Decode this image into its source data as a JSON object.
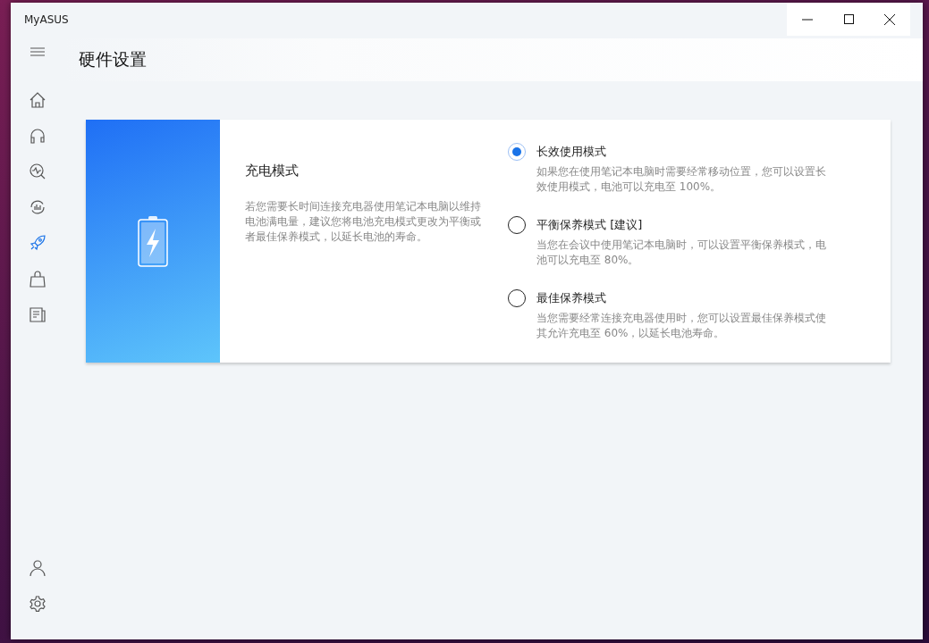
{
  "window": {
    "title": "MyASUS"
  },
  "sidebar": {
    "items": [
      {
        "kind": "home",
        "selected": false
      },
      {
        "kind": "headset",
        "selected": false
      },
      {
        "kind": "diagnostics",
        "selected": false
      },
      {
        "kind": "sync",
        "selected": false
      },
      {
        "kind": "rocket",
        "selected": true
      },
      {
        "kind": "bag",
        "selected": false
      },
      {
        "kind": "news",
        "selected": false
      }
    ],
    "bottom_items": [
      {
        "kind": "user",
        "selected": false
      },
      {
        "kind": "settings",
        "selected": false
      }
    ]
  },
  "page": {
    "title": "硬件设置"
  },
  "card": {
    "title": "充电模式",
    "description": "若您需要长时间连接充电器使用笔记本电脑以维持电池满电量，建议您将电池充电模式更改为平衡或者最佳保养模式，以延长电池的寿命。",
    "options": [
      {
        "label": "长效使用模式",
        "description": "如果您在使用笔记本电脑时需要经常移动位置，您可以设置长效使用模式，电池可以充电至 100%。",
        "selected": true
      },
      {
        "label": "平衡保养模式 [建议]",
        "description": "当您在会议中使用笔记本电脑时，可以设置平衡保养模式，电池可以充电至 80%。",
        "selected": false
      },
      {
        "label": "最佳保养模式",
        "description": "当您需要经常连接充电器使用时，您可以设置最佳保养模式使其允许充电至 60%，以延长电池寿命。",
        "selected": false
      }
    ]
  }
}
